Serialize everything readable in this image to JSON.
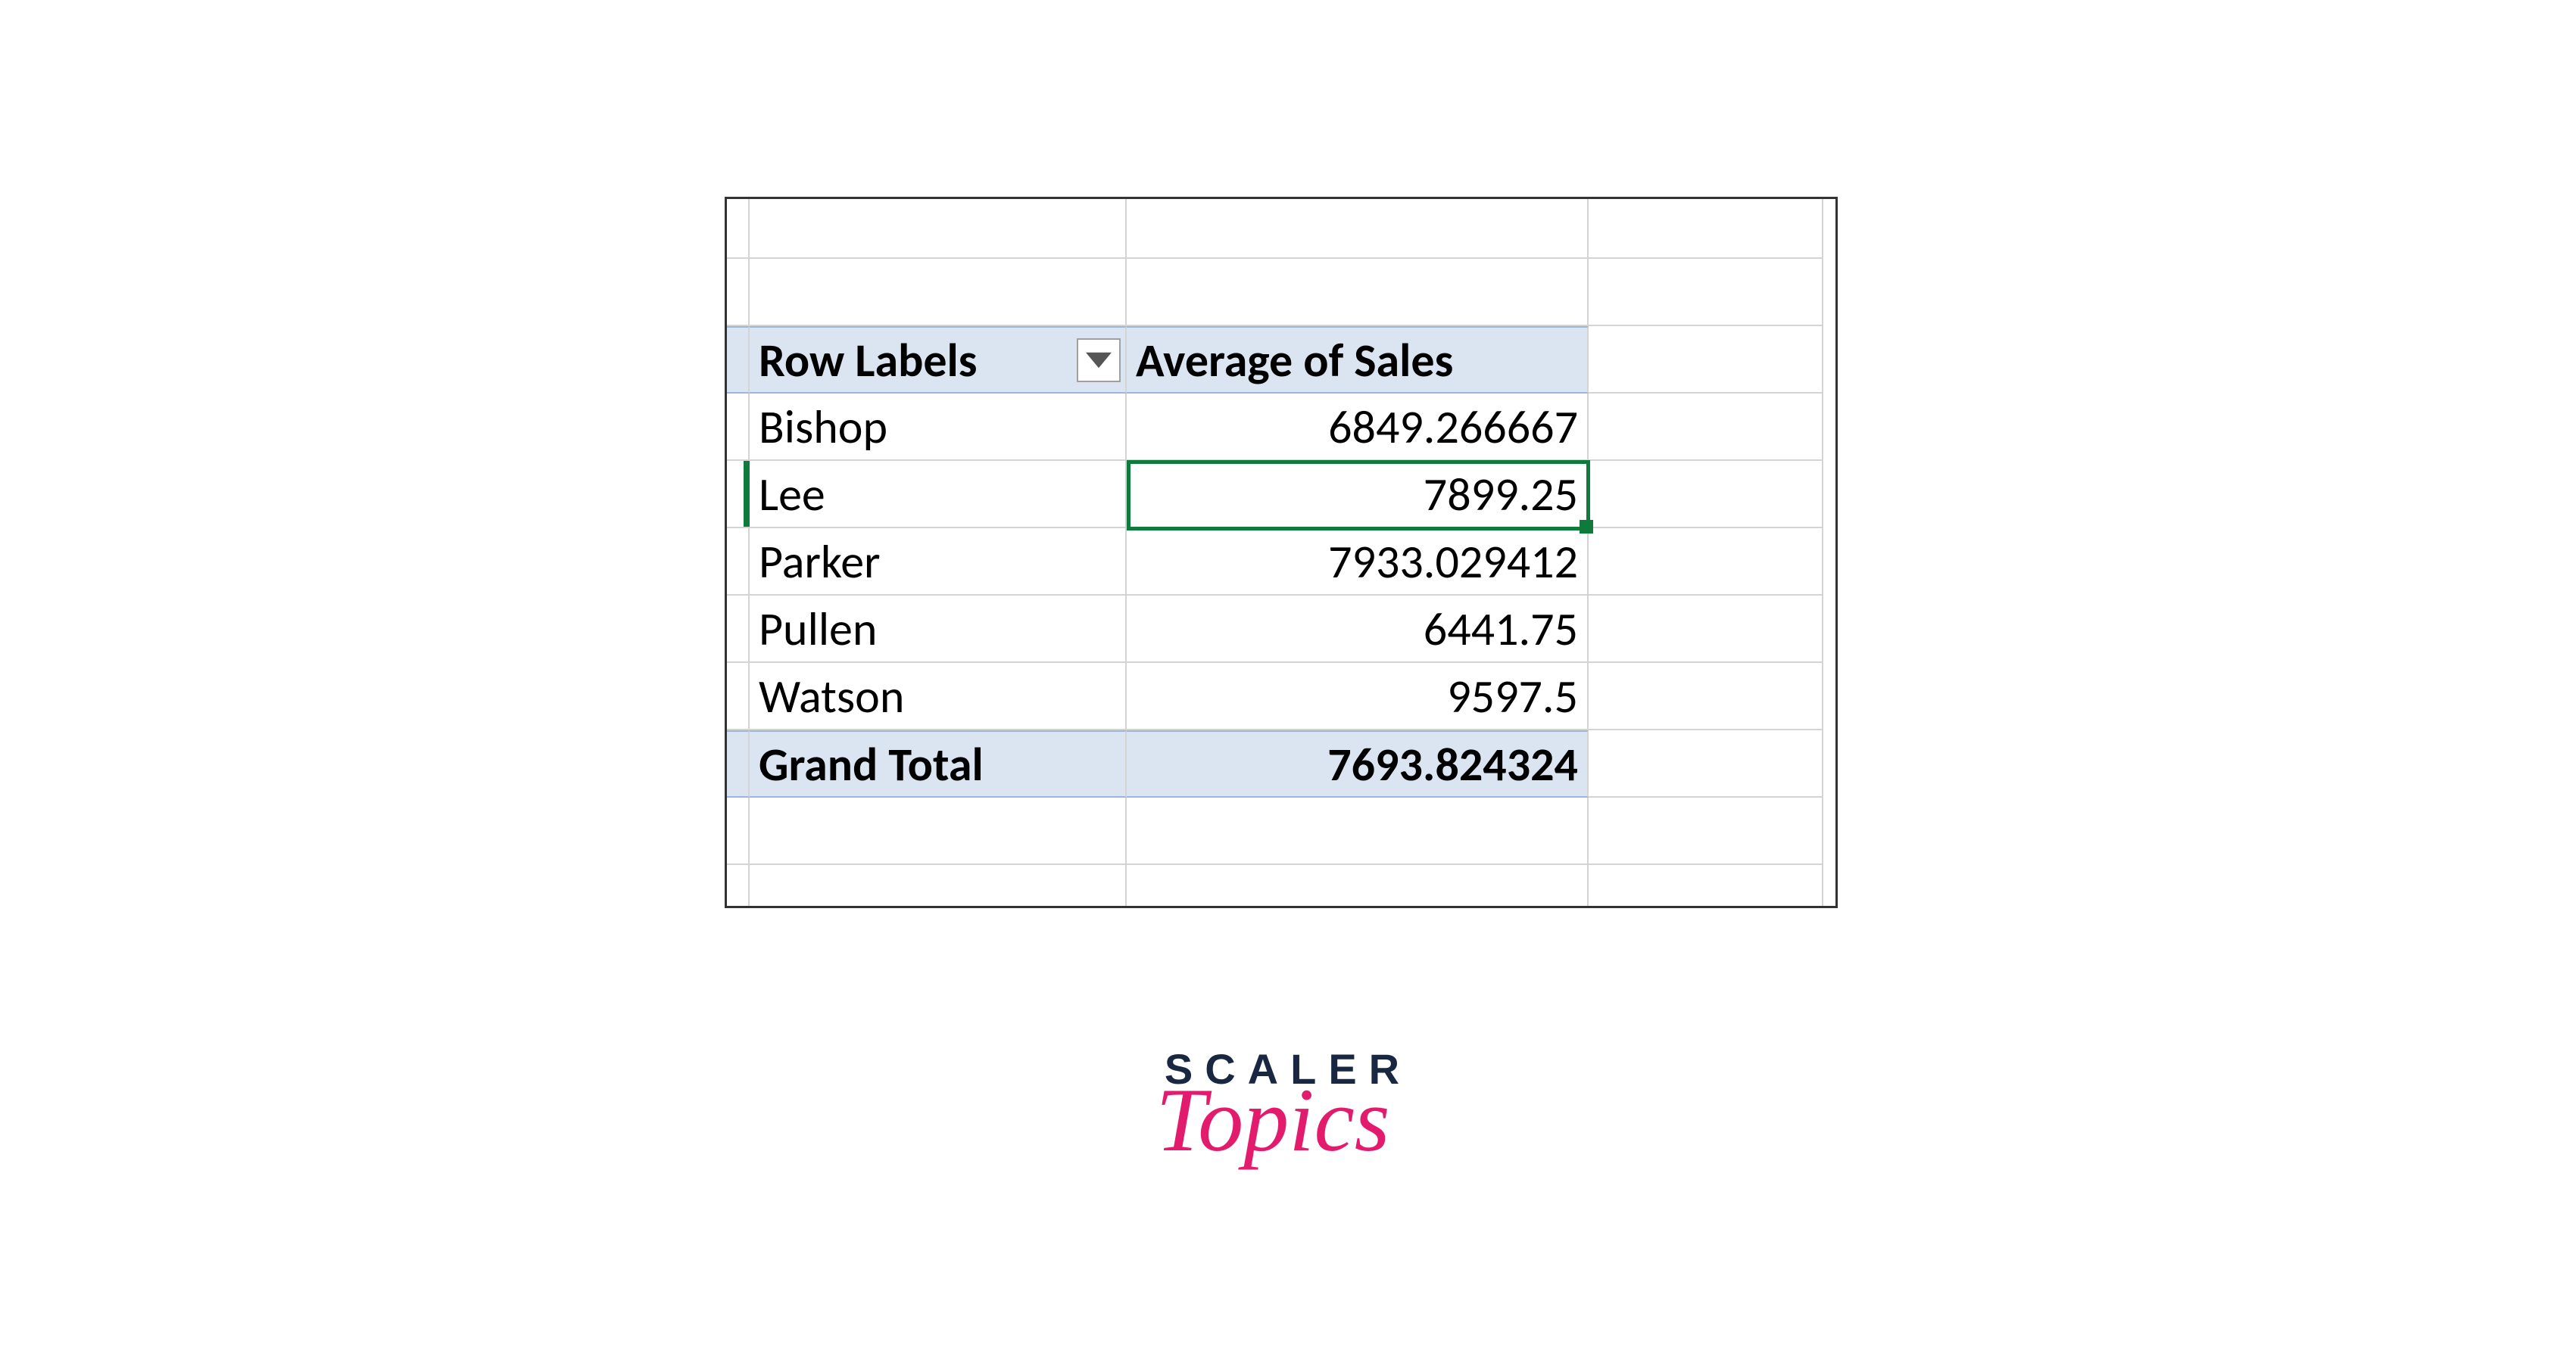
{
  "pivot": {
    "header": {
      "rowLabels": "Row Labels",
      "values": "Average of Sales"
    },
    "rows": [
      {
        "label": "Bishop",
        "value": "6849.266667"
      },
      {
        "label": "Lee",
        "value": "7899.25"
      },
      {
        "label": "Parker",
        "value": "7933.029412"
      },
      {
        "label": "Pullen",
        "value": "6441.75"
      },
      {
        "label": "Watson",
        "value": "9597.5"
      }
    ],
    "grandTotal": {
      "label": "Grand Total",
      "value": "7693.824324"
    }
  },
  "logo": {
    "line1": "SCALER",
    "line2": "Topics"
  }
}
